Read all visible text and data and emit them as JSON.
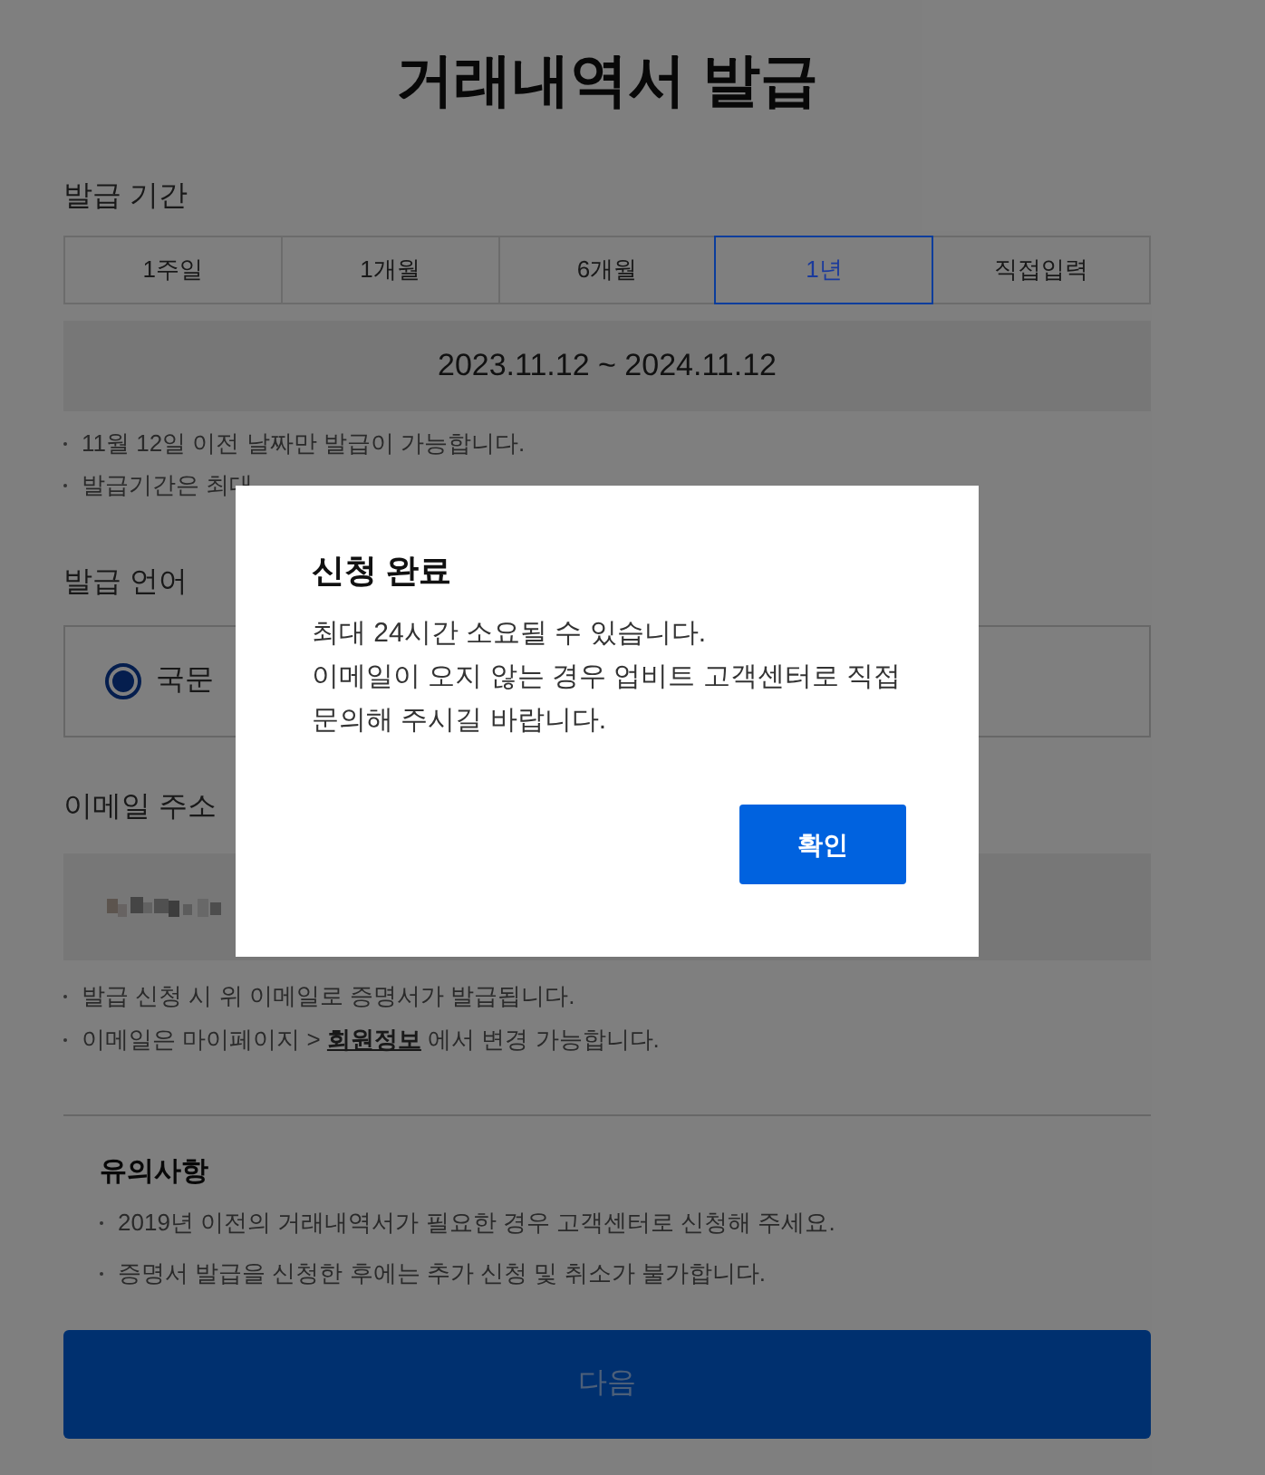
{
  "title": "거래내역서 발급",
  "period": {
    "label": "발급 기간",
    "options": [
      {
        "label": "1주일",
        "selected": false
      },
      {
        "label": "1개월",
        "selected": false
      },
      {
        "label": "6개월",
        "selected": false
      },
      {
        "label": "1년",
        "selected": true
      },
      {
        "label": "직접입력",
        "selected": false
      }
    ],
    "range": "2023.11.12 ~ 2024.11.12",
    "notes": [
      "11월 12일 이전 날짜만 발급이 가능합니다.",
      "발급기간은 최대"
    ]
  },
  "language": {
    "label": "발급 언어",
    "options": [
      {
        "label": "국문",
        "selected": true
      }
    ]
  },
  "email": {
    "label": "이메일 주소",
    "notes": [
      {
        "text": "발급 신청 시 위 이메일로 증명서가 발급됩니다."
      },
      {
        "text": "이메일은 마이페이지 >",
        "link": "회원정보",
        "after": "에서 변경 가능합니다."
      }
    ]
  },
  "cautions": {
    "title": "유의사항",
    "items": [
      "2019년 이전의 거래내역서가 필요한 경우 고객센터로 신청해 주세요.",
      "증명서 발급을 신청한 후에는 추가 신청 및 취소가 불가합니다."
    ]
  },
  "next_button": "다음",
  "dialog": {
    "title": "신청 완료",
    "body": [
      "최대 24시간 소요될 수 있습니다.",
      "이메일이 오지 않는 경우 업비트 고객센터로 직접 문의해 주시길 바랍니다."
    ],
    "confirm": "확인"
  }
}
